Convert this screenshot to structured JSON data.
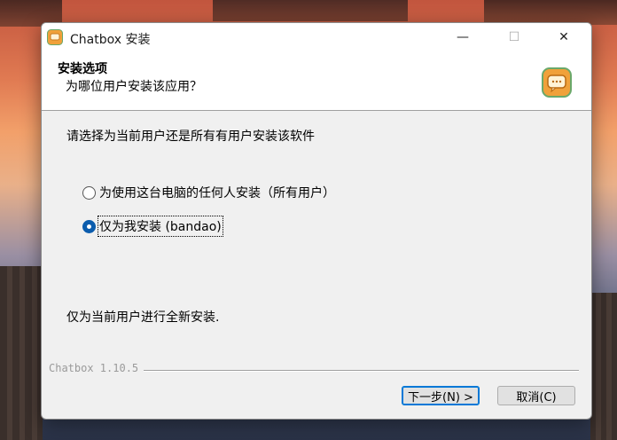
{
  "window": {
    "title": "Chatbox 安装",
    "controls": {
      "minimize": "—",
      "maximize": "☐",
      "close": "✕"
    }
  },
  "header": {
    "title": "安装选项",
    "subtitle": "为哪位用户安装该应用？",
    "icon": "chatbox-app-icon"
  },
  "body": {
    "instruction": "请选择为当前用户还是所有有用户安装该软件",
    "options": [
      {
        "label": "为使用这台电脑的任何人安装（所有用户）",
        "checked": false
      },
      {
        "label": "仅为我安装 (bandao)",
        "checked": true
      }
    ],
    "description": "仅为当前用户进行全新安装."
  },
  "footer": {
    "branding": "Chatbox 1.10.5",
    "next_label": "下一步(N) >",
    "cancel_label": "取消(C)"
  },
  "colors": {
    "accent": "#0078d7",
    "icon_orange": "#f0a13a",
    "icon_green": "#6aa86a"
  }
}
